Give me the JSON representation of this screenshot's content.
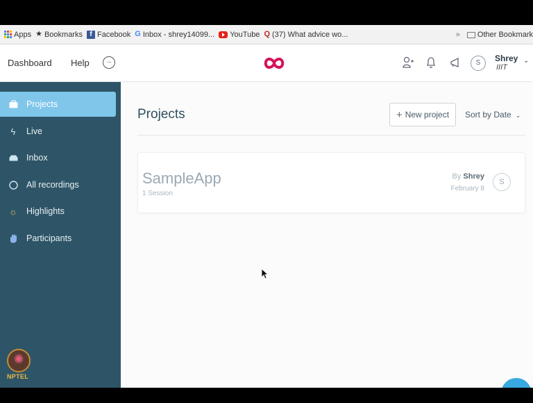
{
  "bookmarks": {
    "items": [
      {
        "label": "Apps",
        "icon": "apps-grid-icon"
      },
      {
        "label": "Bookmarks",
        "icon": "star-icon"
      },
      {
        "label": "Facebook",
        "icon": "facebook-icon"
      },
      {
        "label": "Inbox - shrey14099...",
        "icon": "google-icon"
      },
      {
        "label": "YouTube",
        "icon": "youtube-icon"
      },
      {
        "label": "(37) What advice wo...",
        "icon": "quora-icon"
      }
    ],
    "overflow": "»",
    "other_bookmarks": "Other Bookmark"
  },
  "nav": {
    "dashboard": "Dashboard",
    "help": "Help",
    "more": "···",
    "user": {
      "avatar_initial": "S",
      "name": "Shrey",
      "org": "IIIT"
    }
  },
  "sidebar": {
    "items": [
      {
        "label": "Projects",
        "icon": "briefcase-icon",
        "active": true
      },
      {
        "label": "Live",
        "icon": "lightning-icon"
      },
      {
        "label": "Inbox",
        "icon": "inbox-icon"
      },
      {
        "label": "All recordings",
        "icon": "circle-icon"
      },
      {
        "label": "Highlights",
        "icon": "sun-icon"
      },
      {
        "label": "Participants",
        "icon": "hand-icon"
      }
    ],
    "watermark": "NPTEL"
  },
  "main": {
    "title": "Projects",
    "new_project": "New project",
    "sort": "Sort by Date",
    "projects": [
      {
        "name": "SampleApp",
        "sessions": "1 Session",
        "by_prefix": "By",
        "owner": "Shrey",
        "date": "February 8",
        "avatar_initial": "S"
      }
    ]
  },
  "colors": {
    "sidebar_bg": "#2e5567",
    "sidebar_active": "#7fc6ea",
    "logo": "#d4145a",
    "fab": "#3aa8e0"
  }
}
